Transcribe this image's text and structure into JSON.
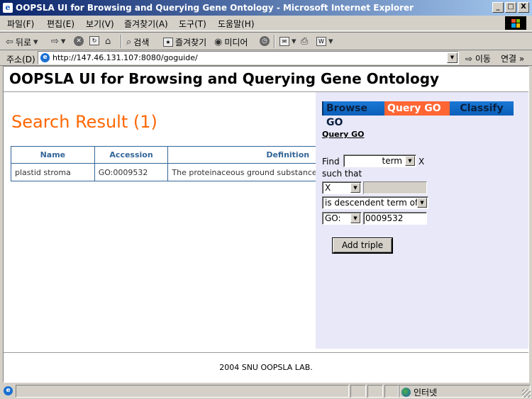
{
  "window": {
    "title": "OOPSLA UI for Browsing and Querying Gene Ontology - Microsoft Internet Explorer",
    "minimize": "_",
    "maximize": "□",
    "close": "X"
  },
  "menu": {
    "items": [
      "파일(F)",
      "편집(E)",
      "보기(V)",
      "즐겨찾기(A)",
      "도구(T)",
      "도움말(H)"
    ]
  },
  "toolbar": {
    "back": "뒤로",
    "search": "검색",
    "favorites": "즐겨찾기",
    "media": "미디어"
  },
  "address": {
    "label": "주소(D)",
    "url": "http://147.46.131.107:8080/goguide/",
    "go": "이동",
    "links": "연결"
  },
  "page": {
    "title": "OOPSLA UI for Browsing and Querying Gene Ontology",
    "search_heading": "Search Result (1)",
    "footer": "2004 SNU OOPSLA LAB."
  },
  "results": {
    "columns": [
      "Name",
      "Accession",
      "Definition"
    ],
    "rows": [
      {
        "name": "plastid stroma",
        "accession": "GO:0009532",
        "definition": "The proteinaceous ground substance of the plastid."
      }
    ]
  },
  "panel": {
    "tabs": [
      "Browse GO",
      "Query GO",
      "Classify"
    ],
    "heading": "Query GO",
    "find_label": "Find",
    "find_select": "term",
    "x_label": "X",
    "such_that": "such that",
    "subject_select": "X",
    "relation_select": "is descendent term of",
    "prefix_select": "GO:",
    "id_value": "0009532",
    "add_button": "Add triple"
  },
  "status": {
    "zone": "인터넷"
  }
}
